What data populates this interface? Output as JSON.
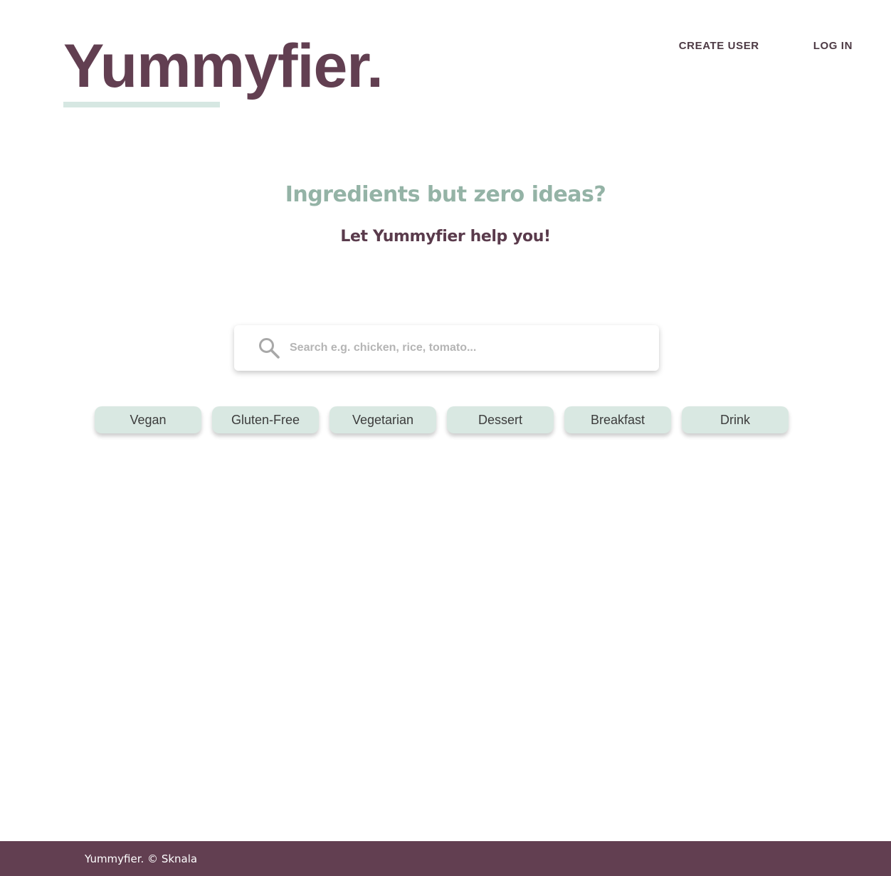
{
  "header": {
    "logo": "Yummyfier.",
    "nav": {
      "create_user": "CREATE USER",
      "log_in": "LOG IN"
    }
  },
  "hero": {
    "headline": "Ingredients but zero ideas?",
    "subheadline": "Let Yummyfier help you!"
  },
  "search": {
    "placeholder": "Search e.g. chicken, rice, tomato...",
    "value": "",
    "icon": "search-icon"
  },
  "tags": [
    "Vegan",
    "Gluten-Free",
    "Vegetarian",
    "Dessert",
    "Breakfast",
    "Drink"
  ],
  "footer": {
    "text": "Yummyfier. © Sknala"
  },
  "colors": {
    "brand": "#623f51",
    "accent_green": "#94b3a6",
    "tag_background": "#d9e8e2"
  }
}
